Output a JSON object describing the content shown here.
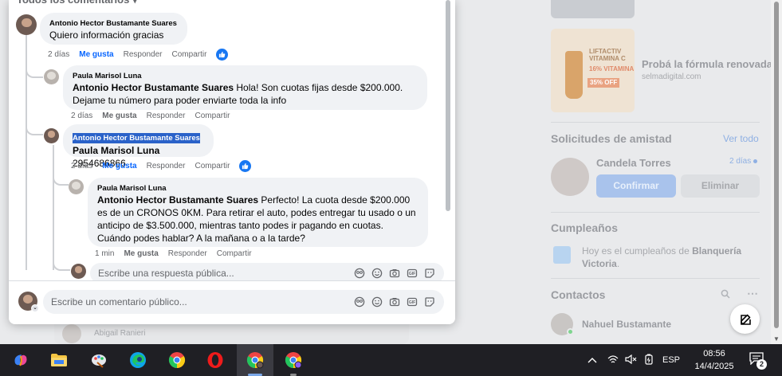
{
  "background": {
    "ad": {
      "title": "Probá la fórmula renovada",
      "domain": "selmadigital.com",
      "img_line1": "LIFTACTIV VITAMINA C",
      "img_line2": "16% VITAMINA",
      "img_line3": "35% OFF"
    },
    "friend_requests": {
      "title": "Solicitudes de amistad",
      "see_all": "Ver todo",
      "name": "Candela Torres",
      "time": "2 días",
      "confirm": "Confirmar",
      "remove": "Eliminar"
    },
    "birthdays": {
      "title": "Cumpleaños",
      "text_pre": "Hoy es el cumpleaños de ",
      "name_a": "Blanquería",
      "name_b": "Victoria",
      "text_end": "."
    },
    "contacts": {
      "title": "Contactos",
      "name": "Nahuel Bustamante"
    },
    "lower_comment_author": "Abigail Ranieri"
  },
  "dialog": {
    "header_peek": "Todos los comentarios ▾",
    "comments": [
      {
        "author": "Antonio Hector Bustamante Suares",
        "text": "Quiero información gracias",
        "time": "2 días",
        "like": "Me gusta",
        "reply": "Responder",
        "share": "Compartir"
      },
      {
        "author": "Paula Marisol Luna",
        "mention": "Antonio Hector Bustamante Suares",
        "text": "Hola! Son cuotas fijas desde $200.000. Dejame tu número para poder enviarte toda la info",
        "time": "2 días",
        "like": "Me gusta",
        "reply": "Responder",
        "share": "Compartir"
      },
      {
        "author": "Antonio Hector Bustamante Suares",
        "mention": "Paula Marisol Luna",
        "text": "2954686866",
        "time": "2 días",
        "like": "Me gusta",
        "reply": "Responder",
        "share": "Compartir"
      },
      {
        "author": "Paula Marisol Luna",
        "mention": "Antonio Hector Bustamante Suares",
        "text": "Perfecto! La cuota desde $200.000 es de un CRONOS 0KM. Para retirar el auto, podes entregar tu usado o un anticipo de $3.500.000, mientras tanto podes ir pagando en cuotas. Cuándo podes hablar? A la mañana o a la tarde?",
        "time": "1 min",
        "like": "Me gusta",
        "reply": "Responder",
        "share": "Compartir"
      }
    ],
    "reply_placeholder": "Escribe una respuesta pública...",
    "comment_placeholder": "Escribe un comentario público..."
  },
  "taskbar": {
    "language": "ESP",
    "time": "08:56",
    "date": "14/4/2025",
    "notifications": "2"
  }
}
